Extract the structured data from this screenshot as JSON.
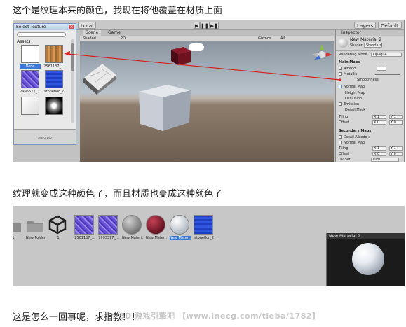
{
  "post": {
    "line1": "这个是纹理本来的颜色，我现在将他覆盖在材质上面",
    "line2": "纹理就变成这种颜色了，而且材质也变成这种颜色了",
    "line3": "这是怎么一回事呢，求指教！！",
    "watermark": "3D 游戏引擎吧 【www.lnecg.com/tieba/1782】"
  },
  "editor": {
    "toolbar": {
      "local_label": "Local",
      "play_icons": [
        "▶",
        "❚❚",
        "▶❚"
      ],
      "layers_label": "Layers",
      "layout_label": "Default"
    },
    "select_texture": {
      "title": "Select Texture",
      "assets_label": "Assets",
      "items": [
        {
          "name": "None",
          "icon": "none-swatch"
        },
        {
          "name": "2561137_...",
          "icon": "wood-texture"
        },
        {
          "name": "7995577_...",
          "icon": "purple-tile-texture"
        },
        {
          "name": "stoneflor_2",
          "icon": "blue-tile-texture"
        },
        {
          "name": "",
          "icon": "white-texture"
        },
        {
          "name": "",
          "icon": "dot-texture"
        }
      ],
      "preview_label": "Preview"
    },
    "scene": {
      "tabs": [
        "Scene",
        "Game"
      ],
      "shading_mode": "Shaded",
      "view_mode": "2D",
      "gizmos_label": "Gizmos",
      "search_placeholder": "All"
    },
    "inspector": {
      "tab_label": "Inspector",
      "material_name": "New Material 2",
      "shader_label": "Shader",
      "shader_value": "Standard",
      "rendering_mode_label": "Rendering Mode",
      "rendering_mode_value": "Opaque",
      "main_maps_label": "Main Maps",
      "albedo_label": "Albedo",
      "metallic_label": "Metallic",
      "smoothness_label": "Smoothness",
      "normal_map_label": "Normal Map",
      "height_map_label": "Height Map",
      "occlusion_label": "Occlusion",
      "emission_label": "Emission",
      "detail_mask_label": "Detail Mask",
      "tiling_label": "Tiling",
      "offset_label": "Offset",
      "tiling_x": "X 1",
      "tiling_y": "Y 1",
      "offset_x": "X 0",
      "offset_y": "Y 0",
      "secondary_maps_label": "Secondary Maps",
      "detail_albedo_label": "Detail Albedo x",
      "secondary_normal_label": "Normal Map",
      "tiling2_label": "Tiling",
      "offset2_label": "Offset",
      "uvset_label": "UV Set",
      "uvset_value": "UV0",
      "tiling2_x": "X 1",
      "tiling2_y": "Y 1",
      "offset2_x": "X 0",
      "offset2_y": "Y 0"
    }
  },
  "project": {
    "assets": [
      {
        "name": "1",
        "icon": "folder-icon"
      },
      {
        "name": "New Folder",
        "icon": "folder-icon"
      },
      {
        "name": "1",
        "icon": "unity-icon"
      },
      {
        "name": "2561137_...",
        "icon": "purple-tile-texture"
      },
      {
        "name": "7995577_...",
        "icon": "purple-tile-texture"
      },
      {
        "name": "New Materi...",
        "icon": "stone-sphere"
      },
      {
        "name": "New Materi...",
        "icon": "red-sphere"
      },
      {
        "name": "New Materi...",
        "icon": "white-sphere"
      },
      {
        "name": "stoneflor_2",
        "icon": "blue-tile-texture"
      }
    ],
    "selected_index": 7,
    "preview_title": "New Material 2"
  }
}
